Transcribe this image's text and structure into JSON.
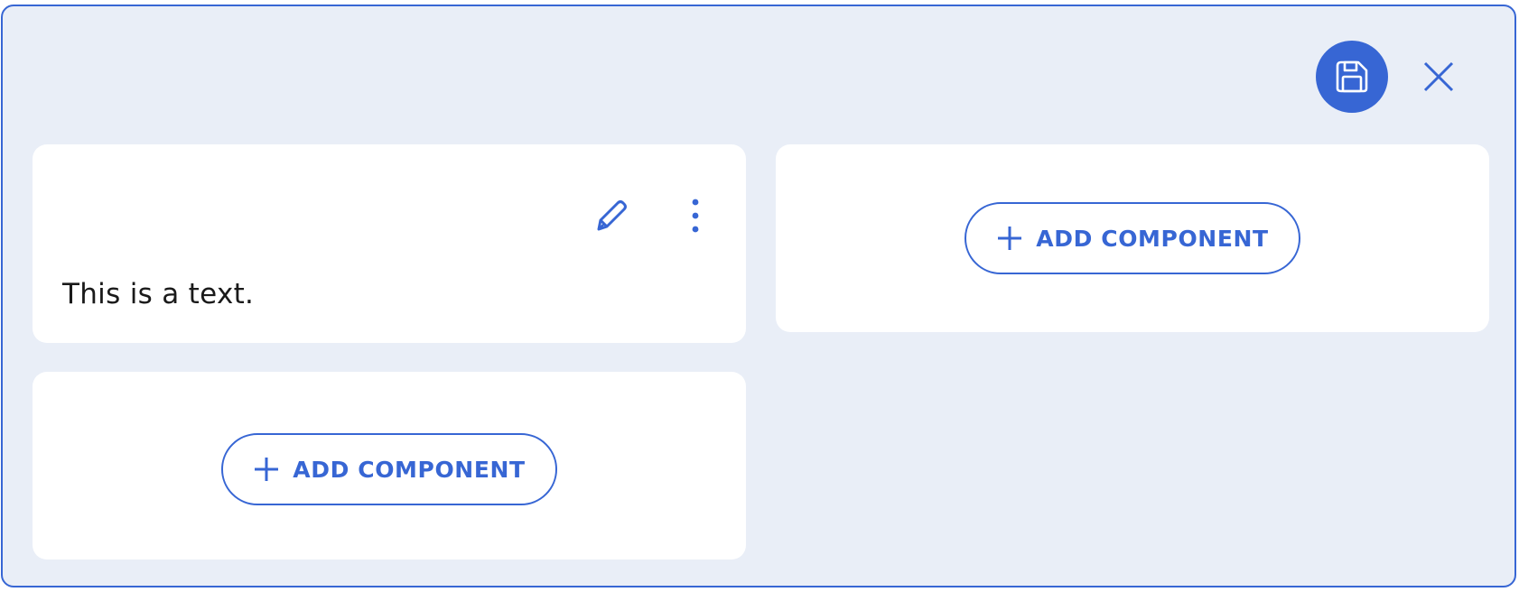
{
  "toolbar": {
    "save_icon": "floppy-disk-icon",
    "close_icon": "close-icon"
  },
  "text_card": {
    "text": "This is a text.",
    "edit_icon": "pencil-icon",
    "more_icon": "more-vertical-icon"
  },
  "add_component": {
    "label": "ADD COMPONENT",
    "icon": "plus-icon"
  },
  "colors": {
    "accent": "#3766d4",
    "panel_background": "#e9eef7",
    "card_background": "#ffffff"
  }
}
